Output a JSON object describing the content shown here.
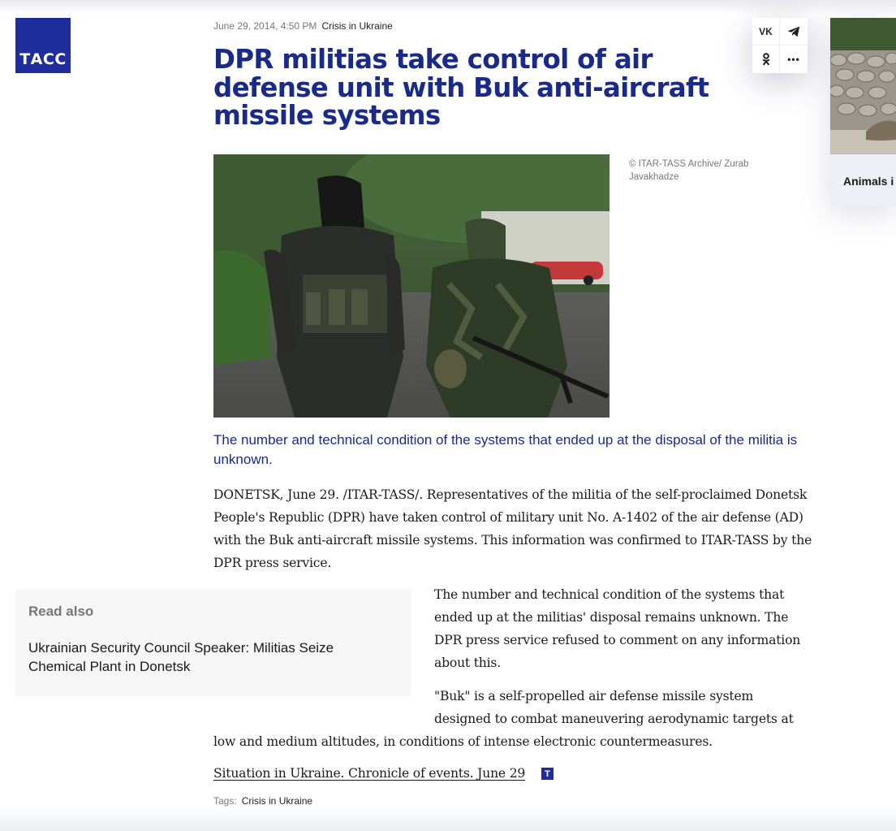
{
  "logo": {
    "text": "ТАСС"
  },
  "article": {
    "date": "June 29, 2014, 4:50 PM",
    "category": "Crisis in Ukraine",
    "title": "DPR militias take control of air defense unit with Buk anti-aircraft missile systems",
    "photo_credit": "© ITAR-TASS Archive/ Zurab Javakhadze",
    "lead": "The number and technical condition of the systems that ended up at the disposal of the militia is unknown.",
    "p1": "DONETSK, June 29. /ITAR-TASS/. Representatives of the militia of the self-proclaimed Donetsk People's Republic (DPR) have taken control of military unit No. A-1402 of the air defense (AD) with the Buk anti-aircraft missile systems. This information was confirmed to ITAR-TASS by the DPR press service.",
    "p2": "The number and technical condition of the systems that ended up at the militias' disposal remains unknown. The DPR press service refused to comment on any information about this.",
    "p3a": "\"Buk\" is a self-propelled air defense missile system designed to combat maneuvering aerodynamic targets at",
    "p3b": "low and medium altitudes, in conditions of intense electronic countermeasures.",
    "chronicle_link": "Situation in Ukraine. Chronicle of events. June 29",
    "chronicle_badge": "T",
    "tags_label": "Tags:",
    "tags": [
      "Crisis in Ukraine"
    ]
  },
  "read_also": {
    "heading": "Read also",
    "link": "Ukrainian Security Council Speaker: Militias Seize Chemical Plant in Donetsk"
  },
  "share": {
    "vk": "VK",
    "telegram": "telegram-icon",
    "ok": "ok-icon",
    "more": "•••"
  },
  "sidebar": {
    "caption": "Animals i"
  },
  "colors": {
    "brand": "#1f2d9c",
    "title": "#1a2a8a"
  }
}
